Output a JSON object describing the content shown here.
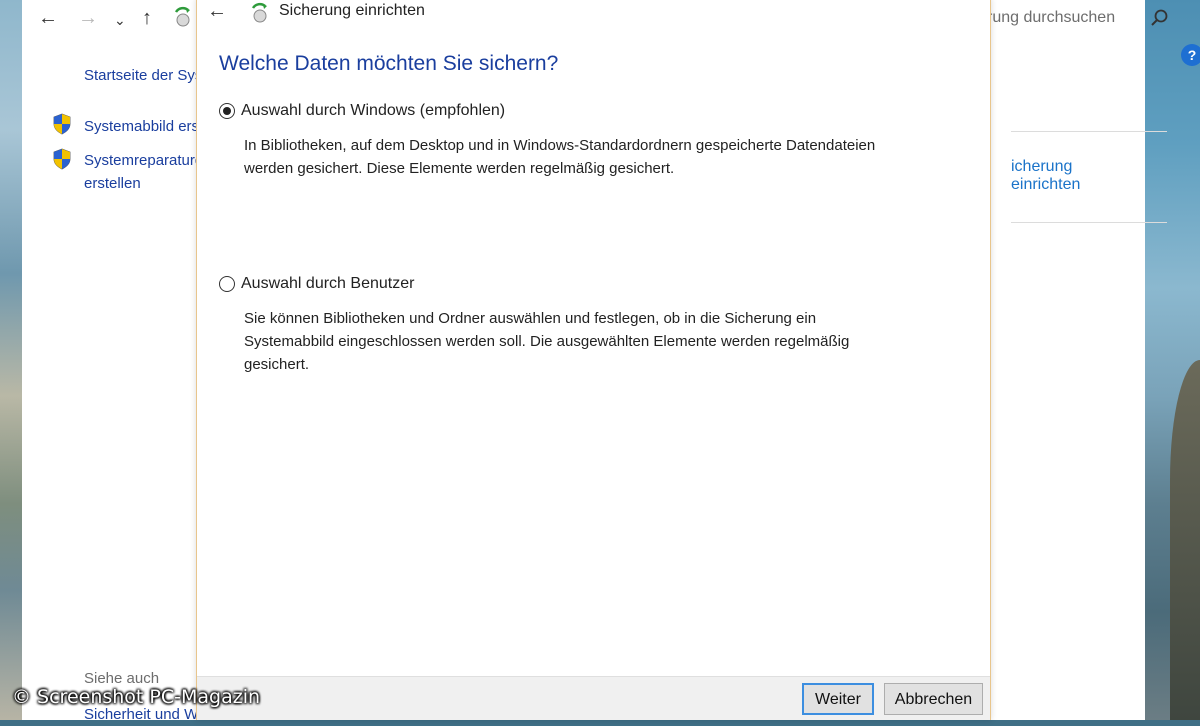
{
  "background_window": {
    "search_placeholder": "rung durchsuchen",
    "help_label": "?",
    "left_links": {
      "home": "Startseite der Syste",
      "system_image": "Systemabbild erste",
      "repair_disc_line1": "Systemreparaturda",
      "repair_disc_line2": "erstellen"
    },
    "see_also_label": "Siehe auch",
    "see_also_link": "Sicherheit und Wa",
    "right_link": "icherung einrichten"
  },
  "dialog": {
    "title": "Sicherung einrichten",
    "heading": "Welche Daten möchten Sie sichern?",
    "options": [
      {
        "label": "Auswahl durch Windows (empfohlen)",
        "checked": true,
        "description_line1": "In Bibliotheken, auf dem Desktop und in Windows-Standardordnern gespeicherte Datendateien",
        "description_line2": "werden gesichert. Diese Elemente werden regelmäßig gesichert."
      },
      {
        "label": "Auswahl durch Benutzer",
        "checked": false,
        "description_line1": "Sie können Bibliotheken und Ordner auswählen und festlegen, ob in die Sicherung ein",
        "description_line2": "Systemabbild eingeschlossen werden soll. Die ausgewählten Elemente werden regelmäßig",
        "description_line3": "gesichert."
      }
    ],
    "buttons": {
      "next": "Weiter",
      "cancel": "Abbrechen"
    }
  },
  "watermark": "© Screenshot PC-Magazin",
  "icons": {
    "back": "back-arrow-icon",
    "forward": "forward-arrow-icon",
    "recent": "chevron-down-icon",
    "up": "up-arrow-icon",
    "backup": "backup-icon",
    "search": "search-icon",
    "shield": "uac-shield-icon",
    "help": "help-icon"
  },
  "colors": {
    "link_blue": "#1a3e9e",
    "heading_blue": "#1a3e9e",
    "accent_blue": "#3c8ee0",
    "dialog_border": "#e8c58c"
  }
}
